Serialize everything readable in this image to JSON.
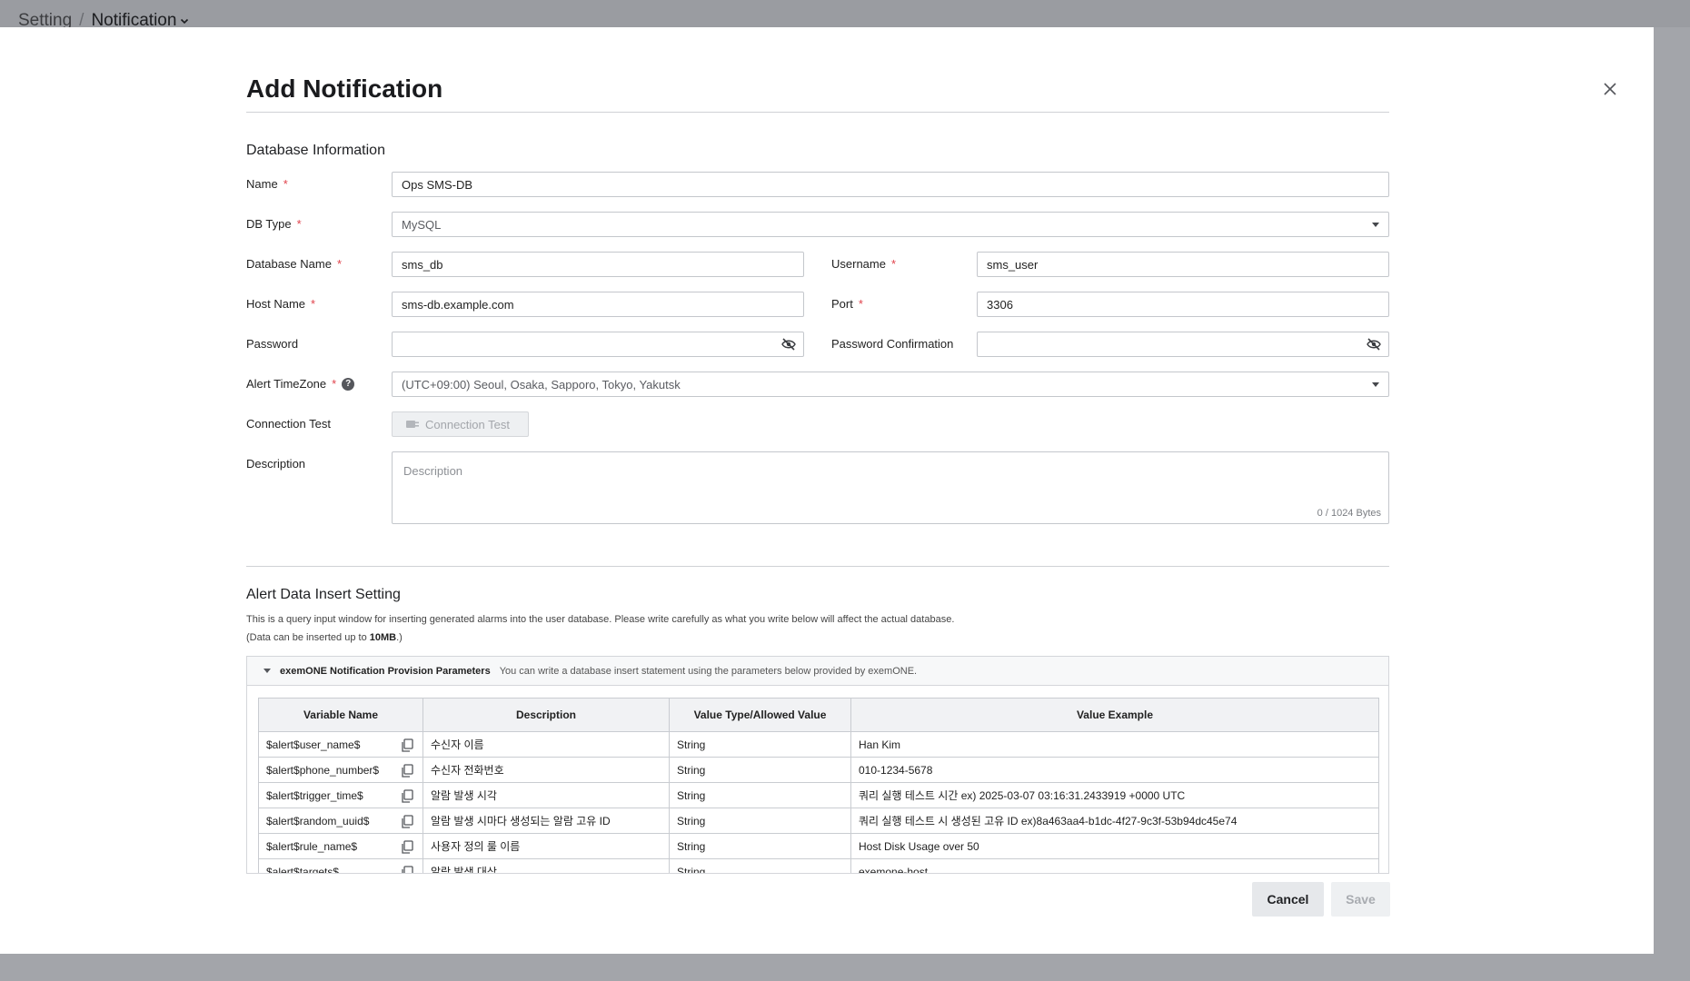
{
  "breadcrumb": {
    "root": "Setting",
    "separator": "/",
    "current": "Notification"
  },
  "modal": {
    "title": "Add Notification"
  },
  "db_section": {
    "title": "Database Information",
    "name": {
      "label": "Name",
      "value": "Ops SMS-DB"
    },
    "db_type": {
      "label": "DB Type",
      "value": "MySQL"
    },
    "database_name": {
      "label": "Database Name",
      "value": "sms_db"
    },
    "username": {
      "label": "Username",
      "value": "sms_user"
    },
    "host_name": {
      "label": "Host Name",
      "value": "sms-db.example.com"
    },
    "port": {
      "label": "Port",
      "value": "3306"
    },
    "password": {
      "label": "Password",
      "value": ""
    },
    "password_confirmation": {
      "label": "Password Confirmation",
      "value": ""
    },
    "alert_timezone": {
      "label": "Alert TimeZone",
      "value": "(UTC+09:00) Seoul, Osaka, Sapporo, Tokyo, Yakutsk"
    },
    "connection_test": {
      "label": "Connection Test",
      "button": "Connection Test"
    },
    "description": {
      "label": "Description",
      "placeholder": "Description",
      "counter": "0 / 1024 Bytes"
    },
    "required_mark": "*"
  },
  "insert_section": {
    "title": "Alert Data Insert Setting",
    "note1": "This is a query input window for inserting generated alarms into the user database. Please write carefully as what you write below will affect the actual database.",
    "note2_prefix": "(Data can be inserted up to ",
    "note2_bold": "10MB",
    "note2_suffix": ".)",
    "panel_title": "exemONE Notification Provision Parameters",
    "panel_desc": "You can write a database insert statement using the parameters below provided by exemONE.",
    "columns": [
      "Variable Name",
      "Description",
      "Value Type/Allowed Value",
      "Value Example"
    ],
    "rows": [
      [
        "$alert$user_name$",
        "수신자 이름",
        "String",
        "Han Kim"
      ],
      [
        "$alert$phone_number$",
        "수신자 전화번호",
        "String",
        "010-1234-5678"
      ],
      [
        "$alert$trigger_time$",
        "알람 발생 시각",
        "String",
        "쿼리 실행 테스트 시간 ex) 2025-03-07 03:16:31.2433919 +0000 UTC"
      ],
      [
        "$alert$random_uuid$",
        "알람 발생 시마다 생성되는 알람 고유 ID",
        "String",
        "쿼리 실행 테스트 시 생성된 고유 ID ex)8a463aa4-b1dc-4f27-9c3f-53b94dc45e74"
      ],
      [
        "$alert$rule_name$",
        "사용자 정의 룰 이름",
        "String",
        "Host Disk Usage over 50"
      ],
      [
        "$alert$targets$",
        "알람 발생 대상",
        "String",
        "exemone-host"
      ]
    ]
  },
  "footer": {
    "cancel": "Cancel",
    "save": "Save"
  },
  "icons": {
    "close": "close-icon",
    "eye": "eye-off-icon",
    "copy": "copy-icon",
    "plug": "plug-icon",
    "help": "help-icon"
  }
}
